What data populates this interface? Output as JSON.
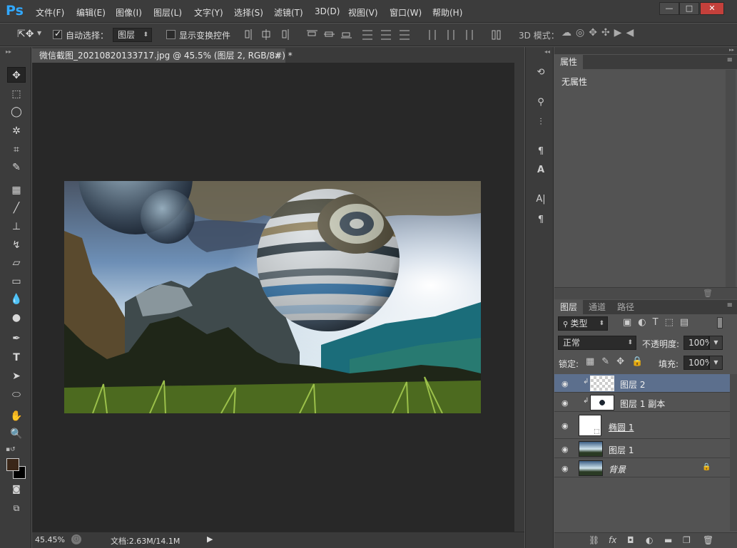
{
  "app": {
    "logo": "Ps"
  },
  "menu": [
    "文件(F)",
    "编辑(E)",
    "图像(I)",
    "图层(L)",
    "文字(Y)",
    "选择(S)",
    "滤镜(T)",
    "3D(D)",
    "视图(V)",
    "窗口(W)",
    "帮助(H)"
  ],
  "window_controls": {
    "minimize": "—",
    "maximize": "□",
    "close": "✕"
  },
  "options": {
    "auto_select_label": "自动选择：",
    "auto_select_value": "图层",
    "show_transform_label": "显示变换控件",
    "mode_3d_label": "3D 模式："
  },
  "document": {
    "tab_title": "微信截图_20210820133717.jpg @ 45.5% (图层 2, RGB/8#) *",
    "tab_close": "×",
    "zoom": "45.45%",
    "doc_info": "文档:2.63M/14.1M"
  },
  "properties": {
    "tab_label": "属性",
    "content": "无属性"
  },
  "layers_panel": {
    "tabs": [
      "图层",
      "通道",
      "路径"
    ],
    "filter_value": "类型",
    "blend_mode": "正常",
    "opacity_label": "不透明度:",
    "opacity_value": "100%",
    "lock_label": "锁定:",
    "fill_label": "填充:",
    "fill_value": "100%",
    "layers": [
      {
        "name": "图层 2",
        "selected": true,
        "clipped": true
      },
      {
        "name": "图层 1 副本",
        "selected": false,
        "clipped": true
      },
      {
        "name": "椭圆 1",
        "selected": false,
        "clipped": false
      },
      {
        "name": "图层 1",
        "selected": false,
        "clipped": false
      },
      {
        "name": "背景",
        "selected": false,
        "clipped": false,
        "locked": true
      }
    ]
  },
  "colors": {
    "accent": "#31a8ff",
    "selected_layer": "#5c6f8d"
  }
}
